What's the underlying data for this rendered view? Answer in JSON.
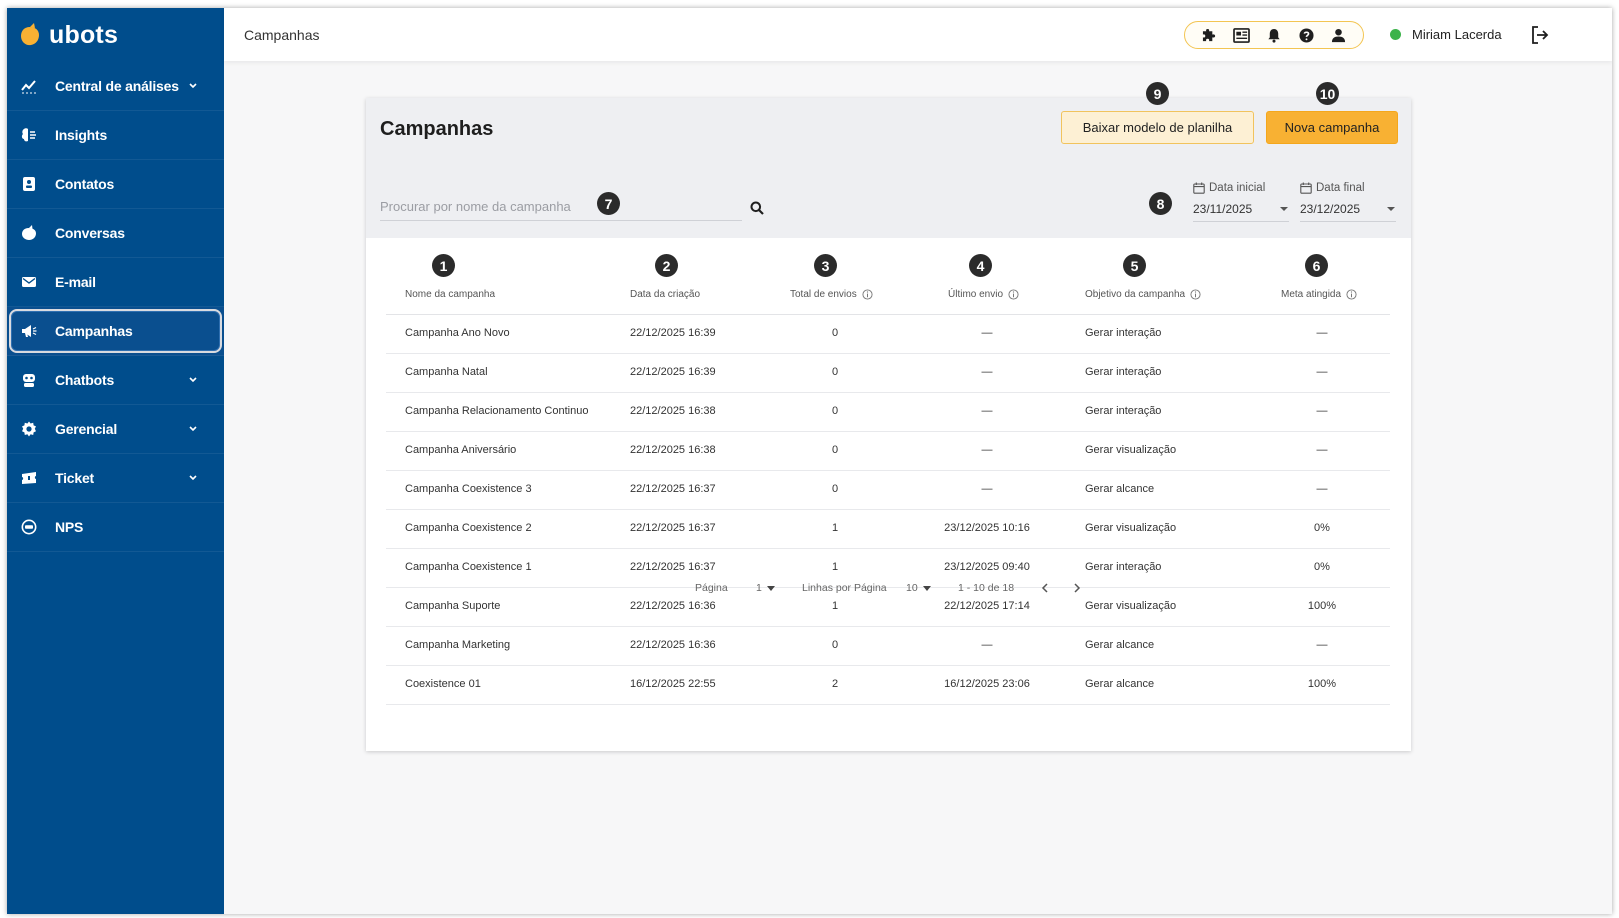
{
  "brand": {
    "name": "ubots"
  },
  "sidebar": {
    "items": [
      {
        "label": "Central de análises",
        "icon": "chart-line-icon",
        "expandable": true
      },
      {
        "label": "Insights",
        "icon": "brain-icon",
        "expandable": false
      },
      {
        "label": "Contatos",
        "icon": "contact-card-icon",
        "expandable": false
      },
      {
        "label": "Conversas",
        "icon": "chat-bubble-icon",
        "expandable": false
      },
      {
        "label": "E-mail",
        "icon": "envelope-icon",
        "expandable": false
      },
      {
        "label": "Campanhas",
        "icon": "megaphone-icon",
        "expandable": false,
        "active": true
      },
      {
        "label": "Chatbots",
        "icon": "robot-icon",
        "expandable": true
      },
      {
        "label": "Gerencial",
        "icon": "gear-icon",
        "expandable": true
      },
      {
        "label": "Ticket",
        "icon": "ticket-icon",
        "expandable": true
      },
      {
        "label": "NPS",
        "icon": "nps-icon",
        "expandable": false
      }
    ]
  },
  "topbar": {
    "title": "Campanhas",
    "tools": [
      "puzzle-icon",
      "news-icon",
      "bell-icon",
      "help-icon",
      "user-icon"
    ],
    "user": {
      "name": "Miriam Lacerda",
      "status_color": "#3cb34a"
    },
    "logout_icon": "logout-icon"
  },
  "page": {
    "title": "Campanhas",
    "download_button": "Baixar modelo de planilha",
    "new_button": "Nova campanha",
    "search_placeholder": "Procurar por nome da campanha",
    "date_start": {
      "label": "Data inicial",
      "value": "23/11/2025"
    },
    "date_end": {
      "label": "Data final",
      "value": "23/12/2025"
    },
    "badges": [
      "1",
      "2",
      "3",
      "4",
      "5",
      "6",
      "7",
      "8",
      "9",
      "10"
    ]
  },
  "table": {
    "columns": [
      "Nome da campanha",
      "Data da criação",
      "Total de envios",
      "Último envio",
      "Objetivo da campanha",
      "Meta atingida"
    ],
    "rows": [
      [
        "Campanha Ano Novo",
        "22/12/2025 16:39",
        "0",
        "—",
        "Gerar interação",
        "—"
      ],
      [
        "Campanha Natal",
        "22/12/2025 16:39",
        "0",
        "—",
        "Gerar interação",
        "—"
      ],
      [
        "Campanha Relacionamento Continuo",
        "22/12/2025 16:38",
        "0",
        "—",
        "Gerar interação",
        "—"
      ],
      [
        "Campanha Aniversário",
        "22/12/2025 16:38",
        "0",
        "—",
        "Gerar visualização",
        "—"
      ],
      [
        "Campanha Coexistence 3",
        "22/12/2025 16:37",
        "0",
        "—",
        "Gerar alcance",
        "—"
      ],
      [
        "Campanha Coexistence 2",
        "22/12/2025 16:37",
        "1",
        "23/12/2025 10:16",
        "Gerar visualização",
        "0%"
      ],
      [
        "Campanha Coexistence 1",
        "22/12/2025 16:37",
        "1",
        "23/12/2025 09:40",
        "Gerar interação",
        "0%"
      ],
      [
        "Campanha Suporte",
        "22/12/2025 16:36",
        "1",
        "22/12/2025 17:14",
        "Gerar visualização",
        "100%"
      ],
      [
        "Campanha Marketing",
        "22/12/2025 16:36",
        "0",
        "—",
        "Gerar alcance",
        "—"
      ],
      [
        "Coexistence 01",
        "16/12/2025 22:55",
        "2",
        "16/12/2025 23:06",
        "Gerar alcance",
        "100%"
      ]
    ]
  },
  "pagination": {
    "page_label": "Página",
    "page_value": "1",
    "rows_label": "Linhas por Página",
    "rows_value": "10",
    "range": "1 - 10 de 18"
  },
  "colors": {
    "sidebar": "#004d8c",
    "accent": "#f8b133",
    "accent_light": "#fdf0d4"
  }
}
